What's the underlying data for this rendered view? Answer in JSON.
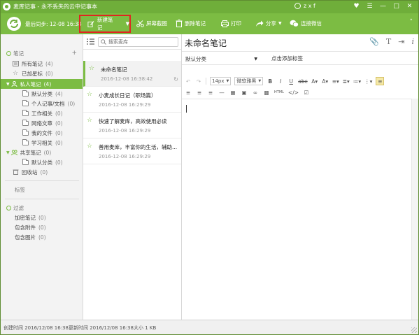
{
  "window": {
    "title": "麦库记事 - 永不丢失的云中记事本",
    "user": "z x f"
  },
  "toolbar": {
    "last_sync": "最后同步: 12-08 16:38",
    "new_note": "新建笔记",
    "screenshot": "屏幕截图",
    "delete_note": "删除笔记",
    "print": "打印",
    "share": "分享",
    "wechat": "连接微信"
  },
  "sidebar": {
    "notes_header": "笔记",
    "all_notes": {
      "label": "所有笔记",
      "count": "(4)"
    },
    "starred": {
      "label": "已加星标",
      "count": "(0)"
    },
    "private_notes": {
      "label": "私人笔记",
      "count": "(4)"
    },
    "private_folders": [
      {
        "label": "默认分类",
        "count": "(4)"
      },
      {
        "label": "个人记事/文档",
        "count": "(0)"
      },
      {
        "label": "工作相关",
        "count": "(0)"
      },
      {
        "label": "网络文章",
        "count": "(0)"
      },
      {
        "label": "我的文件",
        "count": "(0)"
      },
      {
        "label": "学习相关",
        "count": "(0)"
      }
    ],
    "shared_notes": {
      "label": "共享笔记",
      "count": "(0)"
    },
    "shared_folders": [
      {
        "label": "默认分类",
        "count": "(0)"
      }
    ],
    "recycle": {
      "label": "回收站",
      "count": "(0)"
    },
    "tags_header": "标签",
    "filter_header": "过滤",
    "filters": [
      {
        "label": "加密笔记",
        "count": "(0)"
      },
      {
        "label": "包含附件",
        "count": "(0)"
      },
      {
        "label": "包含图片",
        "count": "(0)"
      }
    ]
  },
  "note_list": {
    "search_placeholder": "搜索麦库",
    "notes": [
      {
        "title": "未命名笔记",
        "time": "2016-12-08 16:38:42"
      },
      {
        "title": "小麦成长日记（职场篇）",
        "time": "2016-12-08 16:29:29"
      },
      {
        "title": "快速了解麦库，高效使用必读",
        "time": "2016-12-08 16:29:29"
      },
      {
        "title": "善用麦库，丰富你的生活，辅助...",
        "time": "2016-12-08 16:29:29"
      }
    ]
  },
  "editor": {
    "title": "未命名笔记",
    "category": "默认分类",
    "tag_placeholder": "点击添加标签",
    "font_size": "14px",
    "font_family": "微软雅黑",
    "html_label": "HTML"
  },
  "statusbar": {
    "created": "创建时间 2016/12/08 16:38",
    "updated": "更新时间 2016/12/08 16:38",
    "size": "大小 1 KB"
  }
}
